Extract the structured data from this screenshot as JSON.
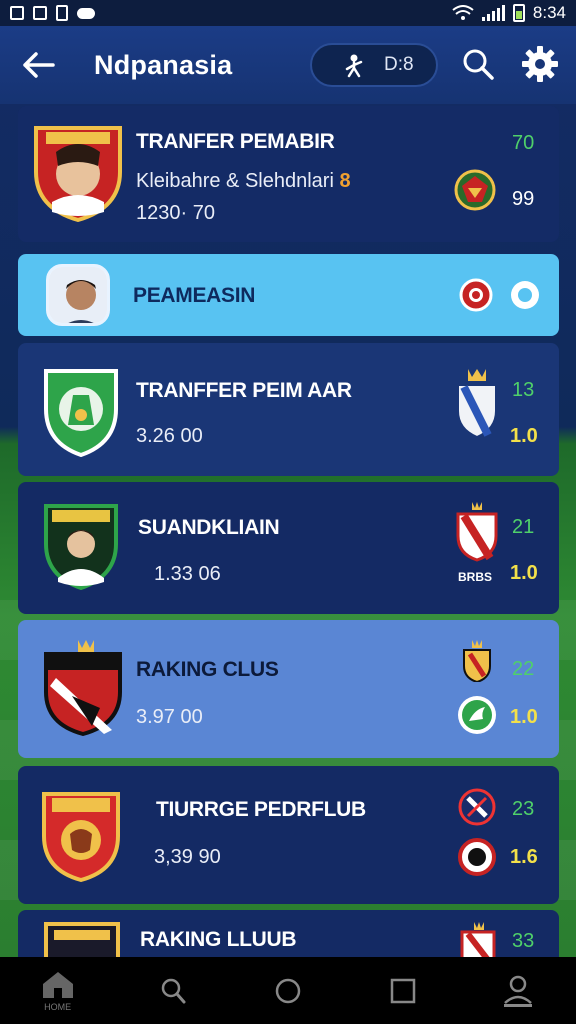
{
  "status_bar": {
    "time": "8:34"
  },
  "app_bar": {
    "title": "Ndpanasia",
    "pill_text": "D:8"
  },
  "list": [
    {
      "title": "TRANFER PEMABIR",
      "subtitle": "Kleibahre & Slehdnlari",
      "subtitle_badge": "8",
      "meta": "1230· 70",
      "score_top": "70",
      "score_bottom": "99"
    },
    {
      "title": "PEAMEASIN"
    },
    {
      "title": "TRANFFER PEIM AAR",
      "meta": "3.26 00",
      "score_top": "13",
      "score_bottom": "1.0"
    },
    {
      "title": "SUANDKLIAIN",
      "meta": "1.33 06",
      "score_top": "21",
      "score_bottom": "1.0",
      "tag": "BRBS"
    },
    {
      "title": "RAKING CLUS",
      "meta": "3.97 00",
      "score_top": "22",
      "score_bottom": "1.0"
    },
    {
      "title": "TIURRGE PEDRFLUB",
      "meta": "3,39 90",
      "score_top": "23",
      "score_bottom": "1.6"
    },
    {
      "title": "RAKING LLUUB",
      "score_top": "33"
    }
  ],
  "bottom_nav": {
    "home_label": "HOME"
  },
  "colors": {
    "accent_green": "#4fd06a",
    "accent_yellow": "#f3e04a",
    "highlight_blue": "#58c3f2"
  },
  "icons": [
    "back-arrow-icon",
    "user-icon",
    "search-icon",
    "gear-icon",
    "home-icon",
    "magnifier-icon",
    "circle-icon",
    "square-icon",
    "profile-icon"
  ]
}
